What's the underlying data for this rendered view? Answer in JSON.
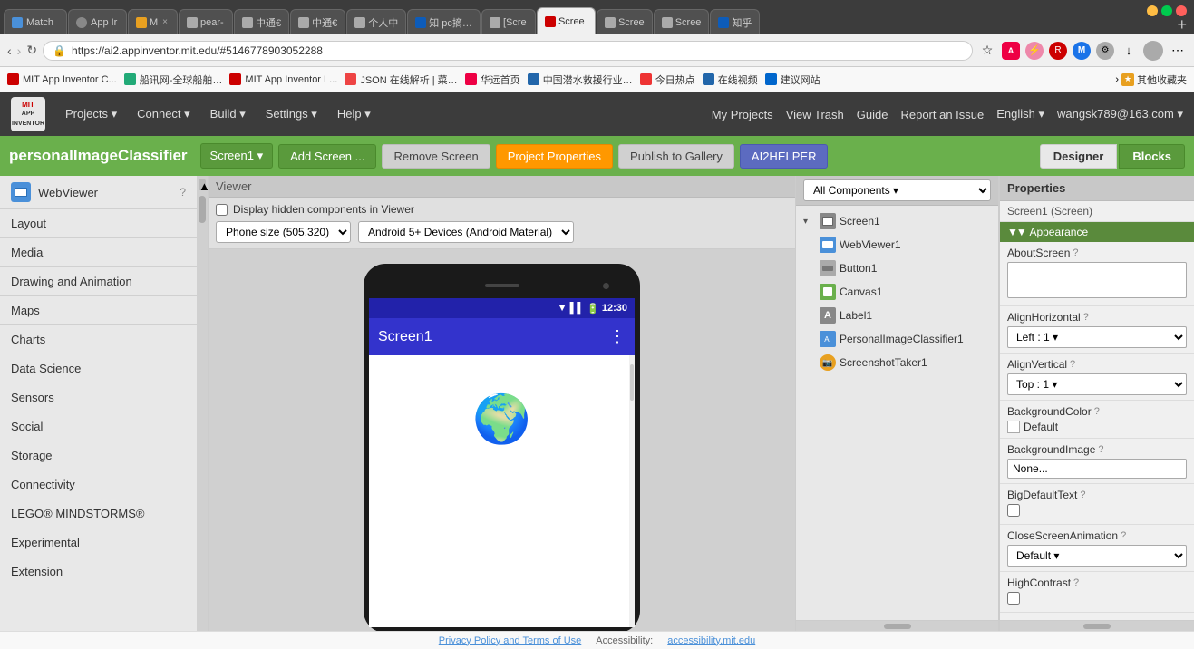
{
  "browser": {
    "tabs": [
      {
        "label": "Match",
        "icon_color": "#4a90d9",
        "active": false
      },
      {
        "label": "App Ir",
        "icon_color": "#888",
        "active": false
      },
      {
        "label": "M ×",
        "icon_color": "#e8a020",
        "active": false,
        "closeable": true
      },
      {
        "label": "pear-",
        "icon_color": "#aaa",
        "active": false
      },
      {
        "label": "中通€",
        "icon_color": "#aaa",
        "active": false
      },
      {
        "label": "中通€",
        "icon_color": "#aaa",
        "active": false
      },
      {
        "label": "个人中",
        "icon_color": "#aaa",
        "active": false
      },
      {
        "label": "知 pc摘…",
        "icon_color": "#aaa",
        "active": false
      },
      {
        "label": "[Scre",
        "icon_color": "#aaa",
        "active": false
      },
      {
        "label": "Scree",
        "icon_color": "#aaa",
        "active": true
      },
      {
        "label": "Scree",
        "icon_color": "#aaa",
        "active": false
      },
      {
        "label": "Scree",
        "icon_color": "#aaa",
        "active": false
      },
      {
        "label": "知乎",
        "icon_color": "#0d5cba",
        "active": false
      }
    ],
    "url": "https://ai2.appinventor.mit.edu/#5146778903052288",
    "bookmarks": [
      {
        "label": "MIT App Inventor C...",
        "icon_color": "#c00"
      },
      {
        "label": "船讯网-全球船舶…",
        "icon_color": "#2a7"
      },
      {
        "label": "MIT App Inventor L...",
        "icon_color": "#c00"
      },
      {
        "label": "JSON 在线解析 | 菜…",
        "icon_color": "#e44"
      },
      {
        "label": "华远首页",
        "icon_color": "#e04"
      },
      {
        "label": "中国潜水救援行业…",
        "icon_color": "#26a"
      },
      {
        "label": "今日热点",
        "icon_color": "#e33"
      },
      {
        "label": "在线视频",
        "icon_color": "#26a"
      },
      {
        "label": "建议网站",
        "icon_color": "#06c"
      },
      {
        "label": "其他收藏夹",
        "icon_color": "#e8a"
      }
    ]
  },
  "mit_header": {
    "logo_text": "MIT\nAPP INVENTOR",
    "nav_items": [
      {
        "label": "Projects ▾"
      },
      {
        "label": "Connect ▾"
      },
      {
        "label": "Build ▾"
      },
      {
        "label": "Settings ▾"
      },
      {
        "label": "Help ▾"
      }
    ],
    "right_links": [
      "My Projects",
      "View Trash",
      "Guide",
      "Report an Issue",
      "English ▾",
      "wangsk789@163.com ▾"
    ]
  },
  "app_toolbar": {
    "project_name": "personalImageClassifier",
    "screen_btn": "Screen1 ▾",
    "add_screen_btn": "Add Screen ...",
    "remove_screen_btn": "Remove Screen",
    "project_props_btn": "Project Properties",
    "publish_btn": "Publish to Gallery",
    "ai2helper_btn": "AI2HELPER",
    "designer_btn": "Designer",
    "blocks_btn": "Blocks"
  },
  "viewer": {
    "header": "Viewer",
    "checkbox_label": "Display hidden components in Viewer",
    "phone_size_label": "Phone size (505,320)",
    "android_version_label": "Android 5+ Devices (Android Material)",
    "screen_title": "Screen1",
    "time": "12:30"
  },
  "palette": {
    "components": [
      {
        "label": "WebViewer",
        "has_icon": true,
        "icon_color": "#4a90d9"
      },
      {
        "label": "Layout",
        "is_category": true
      },
      {
        "label": "Media",
        "is_category": true
      },
      {
        "label": "Drawing and Animation",
        "is_category": true
      },
      {
        "label": "Maps",
        "is_category": true
      },
      {
        "label": "Charts",
        "is_category": true
      },
      {
        "label": "Data Science",
        "is_category": true
      },
      {
        "label": "Sensors",
        "is_category": true
      },
      {
        "label": "Social",
        "is_category": true
      },
      {
        "label": "Storage",
        "is_category": true
      },
      {
        "label": "Connectivity",
        "is_category": true
      },
      {
        "label": "LEGO® MINDSTORMS®",
        "is_category": true
      },
      {
        "label": "Experimental",
        "is_category": true
      },
      {
        "label": "Extension",
        "is_category": true
      }
    ]
  },
  "components": {
    "header": "All Components ▾",
    "tree": [
      {
        "label": "Screen1",
        "icon_color": "#888",
        "level": 0,
        "toggle": "▾",
        "icon_type": "screen"
      },
      {
        "label": "WebViewer1",
        "icon_color": "#4a90d9",
        "level": 1,
        "icon_type": "webviewer"
      },
      {
        "label": "Button1",
        "icon_color": "#888",
        "level": 1,
        "icon_type": "button"
      },
      {
        "label": "Canvas1",
        "icon_color": "#6ab04c",
        "level": 1,
        "icon_type": "canvas"
      },
      {
        "label": "Label1",
        "icon_color": "#888",
        "level": 1,
        "icon_type": "label"
      },
      {
        "label": "PersonalImageClassifier1",
        "icon_color": "#4a90d9",
        "level": 1,
        "icon_type": "ai"
      },
      {
        "label": "ScreenshotTaker1",
        "icon_color": "#e8a020",
        "level": 1,
        "icon_type": "screenshot"
      }
    ]
  },
  "properties": {
    "header": "Properties",
    "screen_label": "Screen1 (Screen)",
    "section_appearance": "▼ Appearance",
    "items": [
      {
        "label": "AboutScreen",
        "has_help": true,
        "type": "textarea",
        "value": ""
      },
      {
        "label": "AlignHorizontal",
        "has_help": true,
        "type": "select",
        "value": "Left : 1 ▾"
      },
      {
        "label": "AlignVertical",
        "has_help": true,
        "type": "select",
        "value": "Top : 1 ▾"
      },
      {
        "label": "BackgroundColor",
        "has_help": true,
        "type": "color",
        "value": "Default",
        "color": "#ffffff"
      },
      {
        "label": "BackgroundImage",
        "has_help": true,
        "type": "input",
        "value": "None..."
      },
      {
        "label": "BigDefaultText",
        "has_help": true,
        "type": "checkbox",
        "value": false
      },
      {
        "label": "CloseScreenAnimation",
        "has_help": true,
        "type": "select",
        "value": "Default ▾"
      },
      {
        "label": "HighContrast",
        "has_help": true,
        "type": "checkbox",
        "value": false
      }
    ]
  },
  "footer": {
    "privacy_link": "Privacy Policy and Terms of Use",
    "accessibility_label": "Accessibility:",
    "accessibility_link": "accessibility.mit.edu"
  }
}
